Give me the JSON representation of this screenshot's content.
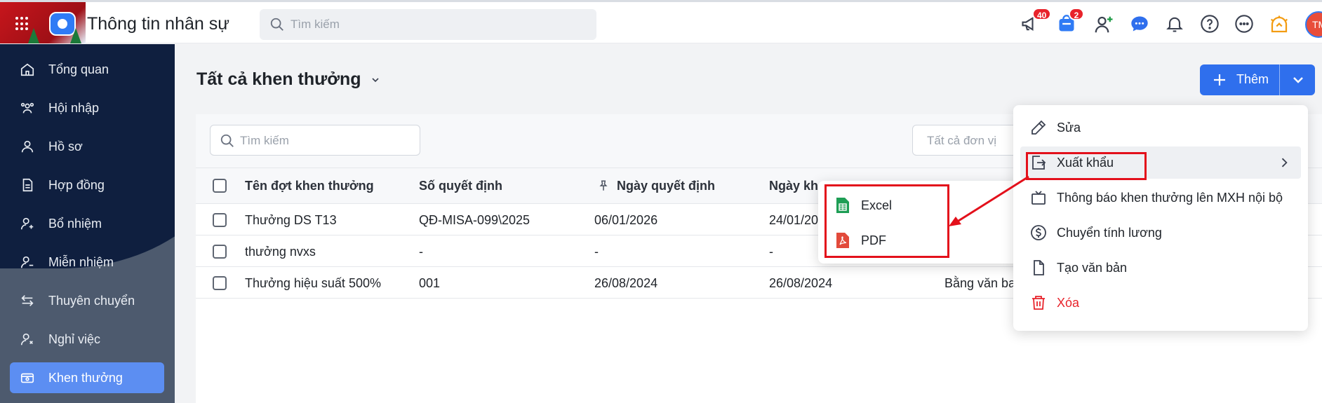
{
  "header": {
    "app_title": "Thông tin nhân sự",
    "search_placeholder": "Tìm kiếm",
    "announcement_count": "40",
    "cart_count": "2",
    "avatar_initials": "TM",
    "icons": [
      "megaphone-icon",
      "store-icon",
      "add-user-icon",
      "chat-icon",
      "bell-icon",
      "help-icon",
      "more-icon",
      "bulb-icon"
    ]
  },
  "sidebar": {
    "items": [
      {
        "label": "Tổng quan",
        "icon": "home-icon"
      },
      {
        "label": "Hội nhập",
        "icon": "group-icon"
      },
      {
        "label": "Hồ sơ",
        "icon": "person-icon"
      },
      {
        "label": "Hợp đồng",
        "icon": "document-icon"
      },
      {
        "label": "Bổ nhiệm",
        "icon": "user-plus-icon"
      },
      {
        "label": "Miễn nhiệm",
        "icon": "user-minus-icon"
      },
      {
        "label": "Thuyên chuyển",
        "icon": "transfer-icon"
      },
      {
        "label": "Nghỉ việc",
        "icon": "user-leave-icon"
      },
      {
        "label": "Khen thưởng",
        "icon": "reward-icon",
        "active": true
      }
    ]
  },
  "page": {
    "title": "Tất cả khen thưởng",
    "add_label": "Thêm"
  },
  "filters": {
    "search_placeholder": "Tìm kiếm",
    "unit_placeholder": "Tất cả đơn vị"
  },
  "table": {
    "columns": [
      "Tên đợt khen thưởng",
      "Số quyết định",
      "Ngày quyết định",
      "Ngày kh"
    ],
    "rows": [
      [
        "Thưởng DS T13",
        "QĐ-MISA-099\\2025",
        "06/01/2026",
        "24/01/20",
        ""
      ],
      [
        "thưởng nvxs",
        "-",
        "-",
        "-",
        ""
      ],
      [
        "Thưởng hiệu suất 500%",
        "001",
        "26/08/2024",
        "26/08/2024",
        "Bằng văn ba"
      ]
    ]
  },
  "action_menu": {
    "items": [
      {
        "label": "Sửa",
        "icon": "pencil-icon"
      },
      {
        "label": "Xuất khẩu",
        "icon": "export-icon"
      },
      {
        "label": "Thông báo khen thưởng lên MXH nội bộ",
        "icon": "tv-icon"
      },
      {
        "label": "Chuyển tính lương",
        "icon": "dollar-icon"
      },
      {
        "label": "Tạo văn bản",
        "icon": "file-icon"
      },
      {
        "label": "Xóa",
        "icon": "trash-icon"
      }
    ]
  },
  "export_menu": {
    "items": [
      {
        "label": "Excel",
        "icon": "excel-icon"
      },
      {
        "label": "PDF",
        "icon": "pdf-icon"
      }
    ]
  },
  "colors": {
    "primary": "#2f6fed",
    "sidebar_dark": "#0f1f3f",
    "sidebar_active": "#5c8ef2",
    "danger": "#e8232b",
    "highlight": "#e3101b"
  }
}
